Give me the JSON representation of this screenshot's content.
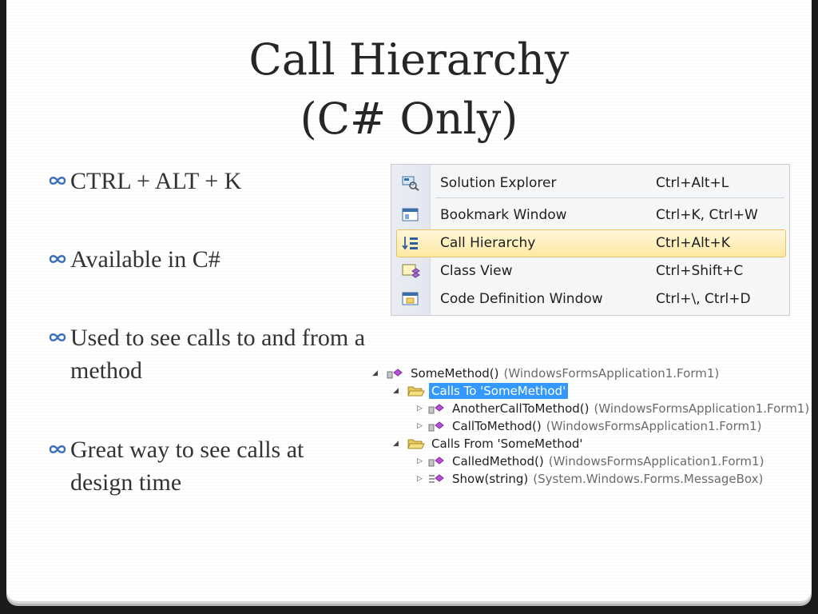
{
  "slide": {
    "title_line1": "Call Hierarchy",
    "title_line2": "(C# Only)",
    "bullets": [
      "CTRL + ALT + K",
      "Available in C#",
      "Used to see calls to and from a method",
      "Great way to see calls at design time"
    ]
  },
  "menu": {
    "items": [
      {
        "label": "Solution Explorer",
        "shortcut": "Ctrl+Alt+L",
        "icon": "solution-explorer-icon"
      },
      {
        "label": "Bookmark Window",
        "shortcut": "Ctrl+K, Ctrl+W",
        "icon": "bookmark-window-icon"
      },
      {
        "label": "Call Hierarchy",
        "shortcut": "Ctrl+Alt+K",
        "icon": "call-hierarchy-icon",
        "highlighted": true
      },
      {
        "label": "Class View",
        "shortcut": "Ctrl+Shift+C",
        "icon": "class-view-icon"
      },
      {
        "label": "Code Definition Window",
        "shortcut": "Ctrl+\\, Ctrl+D",
        "icon": "code-definition-icon"
      }
    ]
  },
  "tree": {
    "root": {
      "name": "SomeMethod()",
      "context": "(WindowsFormsApplication1.Form1)"
    },
    "calls_to": {
      "label": "Calls To 'SomeMethod'",
      "items": [
        {
          "name": "AnotherCallToMethod()",
          "context": "(WindowsFormsApplication1.Form1)"
        },
        {
          "name": "CallToMethod()",
          "context": "(WindowsFormsApplication1.Form1)"
        }
      ]
    },
    "calls_from": {
      "label": "Calls From 'SomeMethod'",
      "items": [
        {
          "name": "CalledMethod()",
          "context": "(WindowsFormsApplication1.Form1)"
        },
        {
          "name": "Show(string)",
          "context": "(System.Windows.Forms.MessageBox)"
        }
      ]
    }
  },
  "colors": {
    "selection": "#3399ff",
    "menu_highlight": "#fde9a3",
    "bullet_mark": "#3a6fb7"
  }
}
